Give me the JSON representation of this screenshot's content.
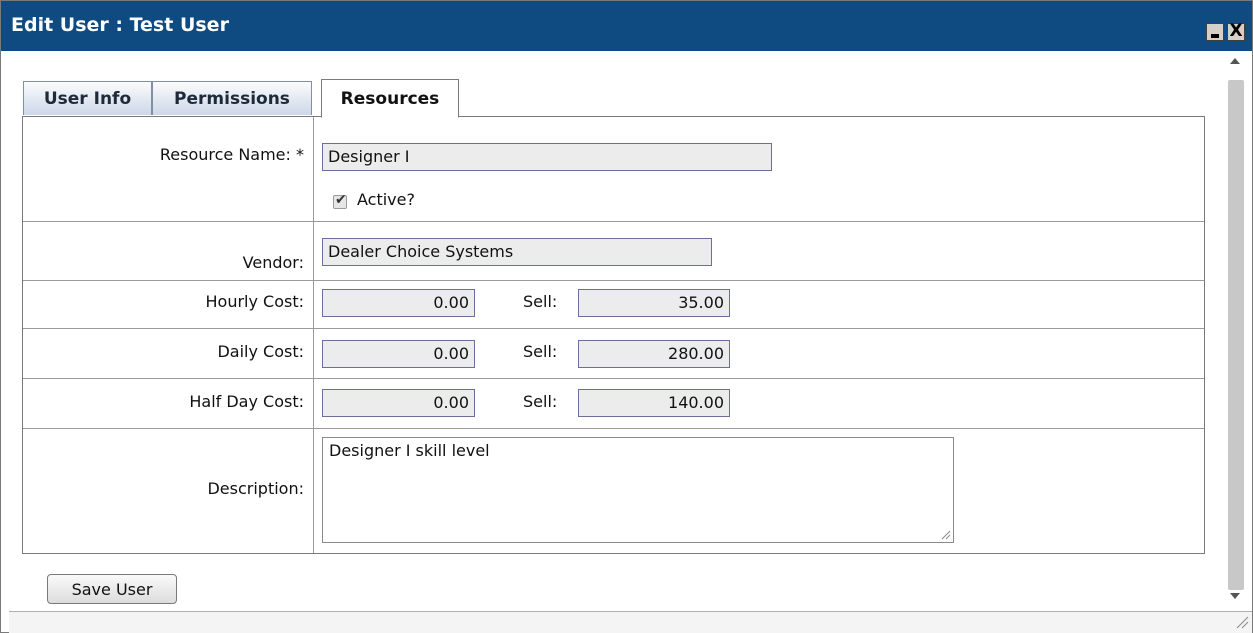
{
  "window": {
    "title": "Edit User : Test User",
    "minimize_label": "_",
    "close_label": "X",
    "accent_color": "#0f4a80"
  },
  "tabs": [
    {
      "label": "User Info",
      "active": false
    },
    {
      "label": "Permissions",
      "active": false
    },
    {
      "label": "Resources",
      "active": true
    }
  ],
  "form": {
    "resource_name": {
      "label": "Resource Name: *",
      "value": "Designer I"
    },
    "active": {
      "label": "Active?",
      "checked": true
    },
    "vendor": {
      "label": "Vendor:",
      "value": "Dealer Choice Systems"
    },
    "hourly": {
      "label": "Hourly Cost:",
      "cost": "0.00",
      "sell_label": "Sell:",
      "sell": "35.00"
    },
    "daily": {
      "label": "Daily Cost:",
      "cost": "0.00",
      "sell_label": "Sell:",
      "sell": "280.00"
    },
    "half_day": {
      "label": "Half Day Cost:",
      "cost": "0.00",
      "sell_label": "Sell:",
      "sell": "140.00"
    },
    "description": {
      "label": "Description:",
      "value": "Designer I skill level"
    }
  },
  "actions": {
    "save_label": "Save User"
  },
  "icons": {
    "minimize": "minimize-icon",
    "close": "close-icon",
    "scroll_up": "chevron-up-icon",
    "scroll_down": "chevron-down-icon",
    "resize": "resize-grip-icon"
  }
}
